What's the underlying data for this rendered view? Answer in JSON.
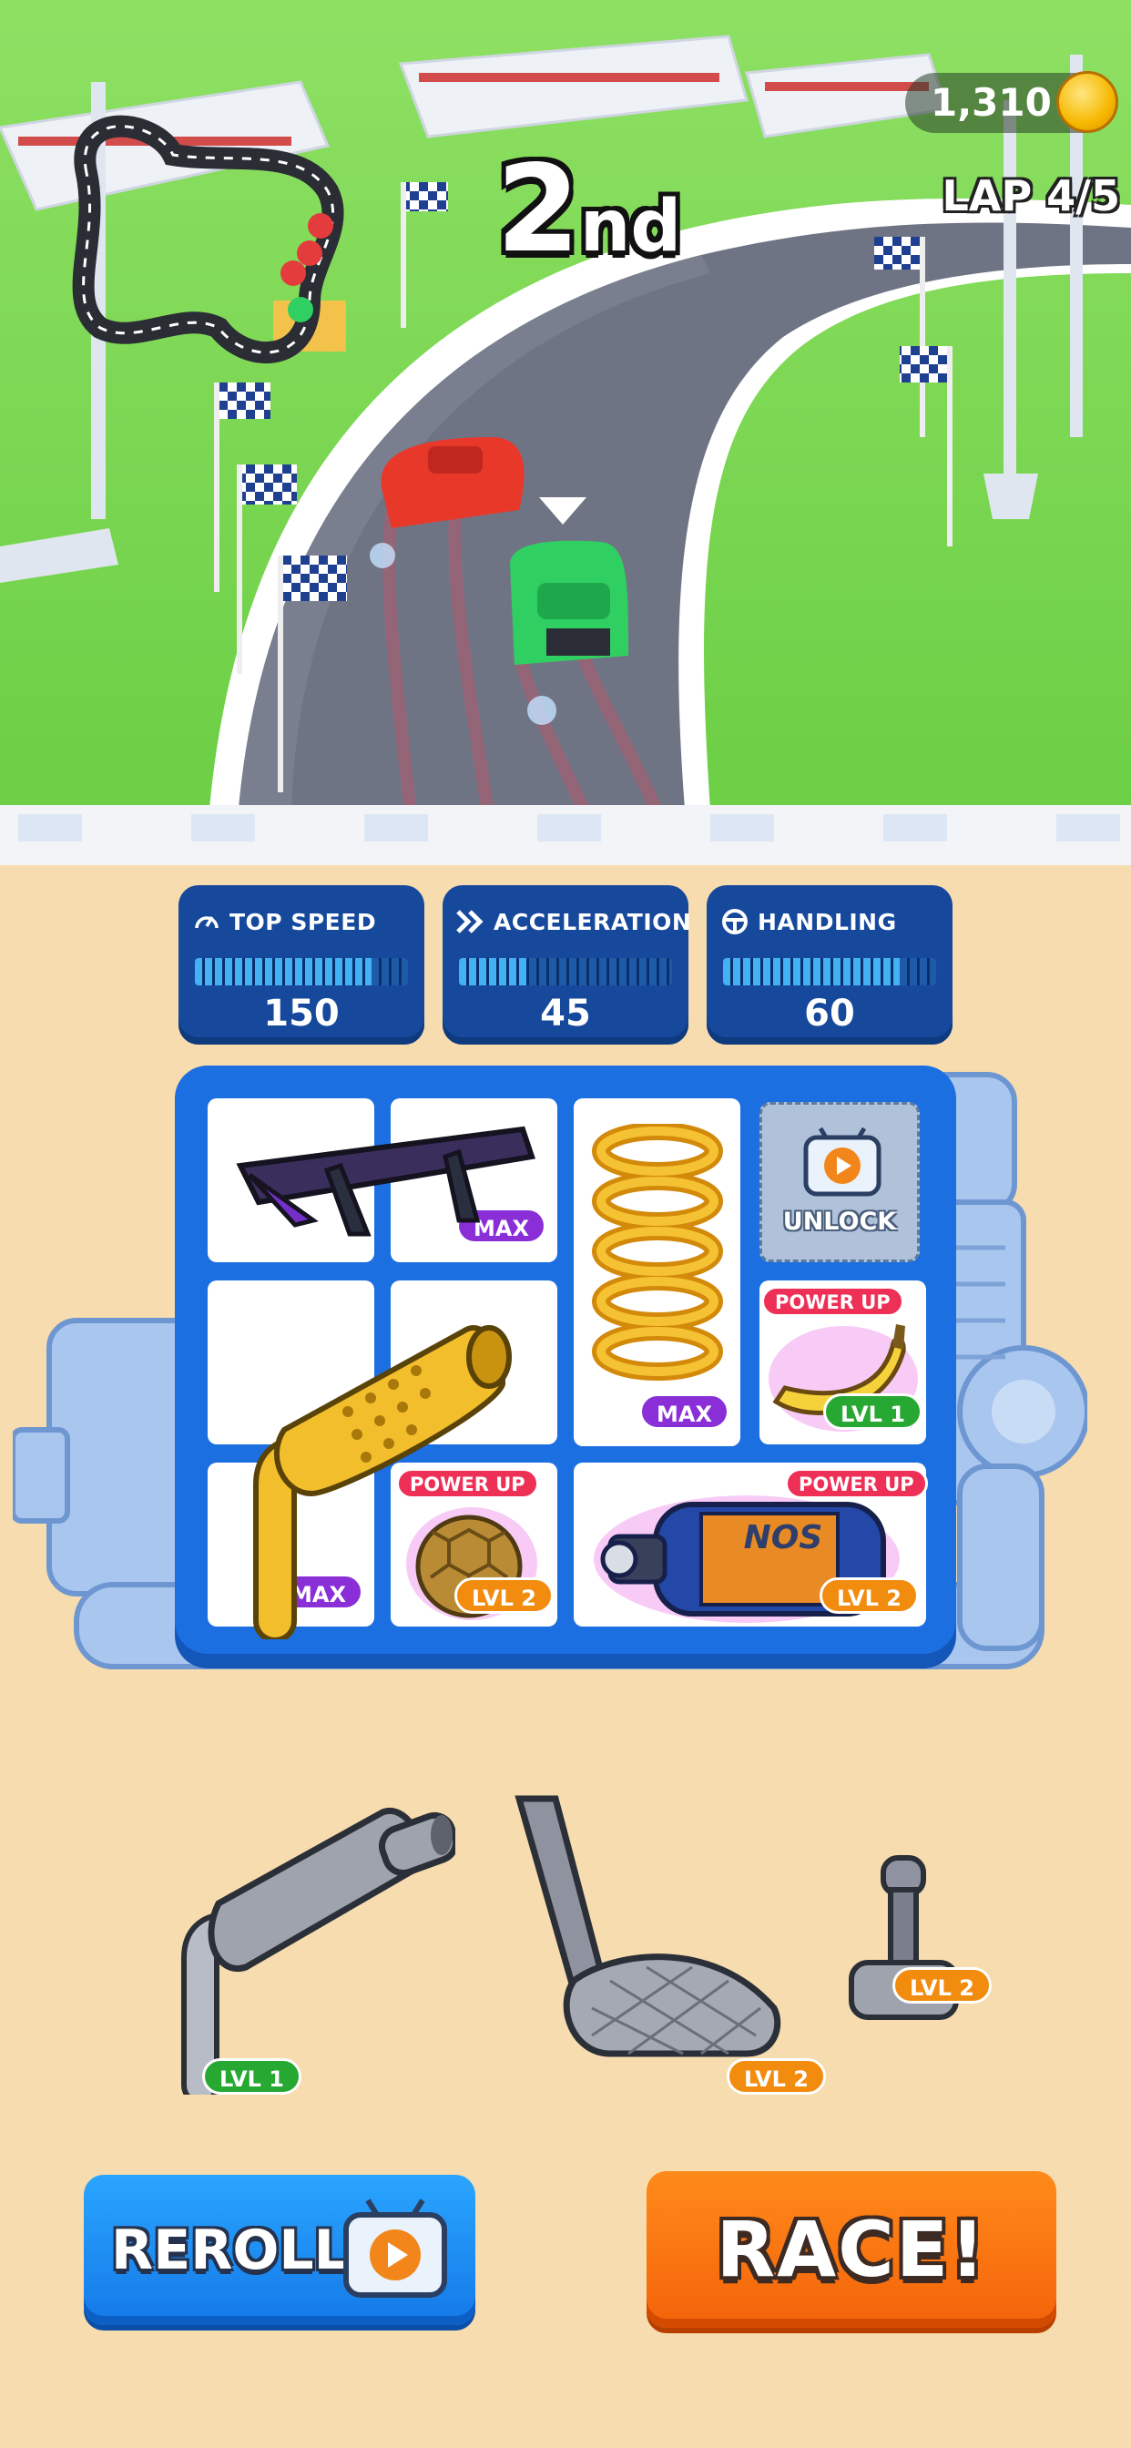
{
  "hud": {
    "coins": "1,310",
    "position_num": "2",
    "position_suffix": "nd",
    "lap": "LAP 4/5"
  },
  "stats": [
    {
      "label": "TOP SPEED",
      "icon": "speedometer-icon",
      "value": "150",
      "level": 0.83
    },
    {
      "label": "ACCELERATION",
      "icon": "chevrons-icon",
      "value": "45",
      "level": 0.33
    },
    {
      "label": "HANDLING",
      "icon": "steering-wheel-icon",
      "value": "60",
      "level": 0.83
    }
  ],
  "grid_badges": {
    "spoiler": "MAX",
    "spring": "MAX",
    "exhaust": "MAX",
    "unlock": "UNLOCK",
    "banana_powerup": "POWER UP",
    "banana_level": "LVL 1",
    "shell_powerup": "POWER UP",
    "shell_level": "LVL 2",
    "nos_powerup": "POWER UP",
    "nos_level": "LVL 2",
    "nos_text": "NOS"
  },
  "tray_parts": [
    {
      "name": "muffler",
      "level": "LVL 1"
    },
    {
      "name": "pedal",
      "level": "LVL 2"
    },
    {
      "name": "shifter",
      "level": "LVL 2"
    }
  ],
  "buttons": {
    "reroll": "REROLL",
    "race": "RACE!"
  },
  "colors": {
    "accent_blue": "#1b6fe0",
    "race_orange": "#f4630a",
    "max_purple": "#8a2fd8",
    "lvl1_green": "#27a832",
    "lvl2_orange": "#f28c0f"
  }
}
